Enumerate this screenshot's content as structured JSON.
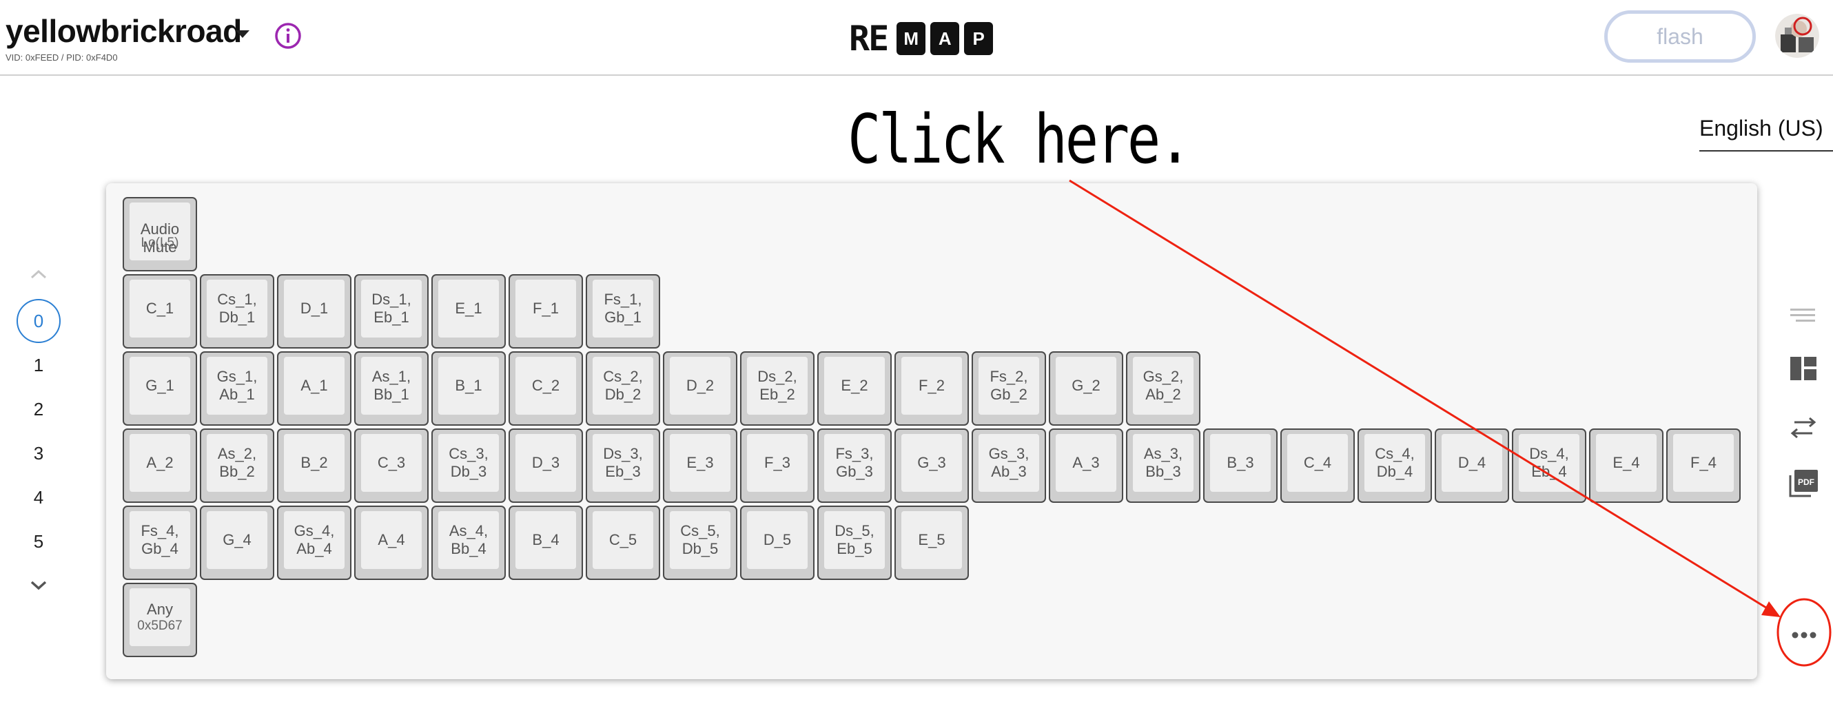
{
  "header": {
    "keyboard_name": "yellowbrickroad",
    "keyboard_ids": "VID: 0xFEED / PID: 0xF4D0",
    "logo": {
      "prefix": "RE",
      "blocks": [
        "M",
        "A",
        "P"
      ]
    },
    "flash_label": "flash"
  },
  "language": "English (US)",
  "annotation": {
    "text": "Click here."
  },
  "layers": {
    "items": [
      "0",
      "1",
      "2",
      "3",
      "4",
      "5"
    ],
    "active": "0"
  },
  "keys": [
    {
      "label": "Audio\nMute",
      "sub": "Lo(L5)",
      "overlap": true
    },
    {
      "label": "C_1"
    },
    {
      "label": "Cs_1,\nDb_1"
    },
    {
      "label": "D_1"
    },
    {
      "label": "Ds_1,\nEb_1"
    },
    {
      "label": "E_1"
    },
    {
      "label": "F_1"
    },
    {
      "label": "Fs_1,\nGb_1"
    },
    {
      "label": "G_1"
    },
    {
      "label": "Gs_1,\nAb_1"
    },
    {
      "label": "A_1"
    },
    {
      "label": "As_1,\nBb_1"
    },
    {
      "label": "B_1"
    },
    {
      "label": "C_2"
    },
    {
      "label": "Cs_2,\nDb_2"
    },
    {
      "label": "D_2"
    },
    {
      "label": "Ds_2,\nEb_2"
    },
    {
      "label": "E_2"
    },
    {
      "label": "F_2"
    },
    {
      "label": "Fs_2,\nGb_2"
    },
    {
      "label": "G_2"
    },
    {
      "label": "Gs_2,\nAb_2"
    },
    {
      "label": "A_2"
    },
    {
      "label": "As_2,\nBb_2"
    },
    {
      "label": "B_2"
    },
    {
      "label": "C_3"
    },
    {
      "label": "Cs_3,\nDb_3"
    },
    {
      "label": "D_3"
    },
    {
      "label": "Ds_3,\nEb_3"
    },
    {
      "label": "E_3"
    },
    {
      "label": "F_3"
    },
    {
      "label": "Fs_3,\nGb_3"
    },
    {
      "label": "G_3"
    },
    {
      "label": "Gs_3,\nAb_3"
    },
    {
      "label": "A_3"
    },
    {
      "label": "As_3,\nBb_3"
    },
    {
      "label": "B_3"
    },
    {
      "label": "C_4"
    },
    {
      "label": "Cs_4,\nDb_4"
    },
    {
      "label": "D_4"
    },
    {
      "label": "Ds_4,\nEb_4"
    },
    {
      "label": "E_4"
    },
    {
      "label": "F_4"
    },
    {
      "label": "Fs_4,\nGb_4"
    },
    {
      "label": "G_4"
    },
    {
      "label": "Gs_4,\nAb_4"
    },
    {
      "label": "A_4"
    },
    {
      "label": "As_4,\nBb_4"
    },
    {
      "label": "B_4"
    },
    {
      "label": "C_5"
    },
    {
      "label": "Cs_5,\nDb_5"
    },
    {
      "label": "D_5"
    },
    {
      "label": "Ds_5,\nEb_5"
    },
    {
      "label": "E_5"
    },
    {
      "label": "Any",
      "sub": "0x5D67"
    }
  ],
  "icons": {
    "info": "info-icon",
    "layers_up": "chevron-up-icon",
    "layers_down": "chevron-down-icon",
    "tools": [
      "notes-lines-icon",
      "layout-grid-icon",
      "swap-arrows-icon",
      "pdf-icon"
    ],
    "more": "more-horizontal-icon"
  },
  "colors": {
    "accent_purple": "#9c27b0",
    "active_layer": "#2b7fd3",
    "annotation_red": "#ee2211",
    "flash_border": "#c9d3ea"
  }
}
